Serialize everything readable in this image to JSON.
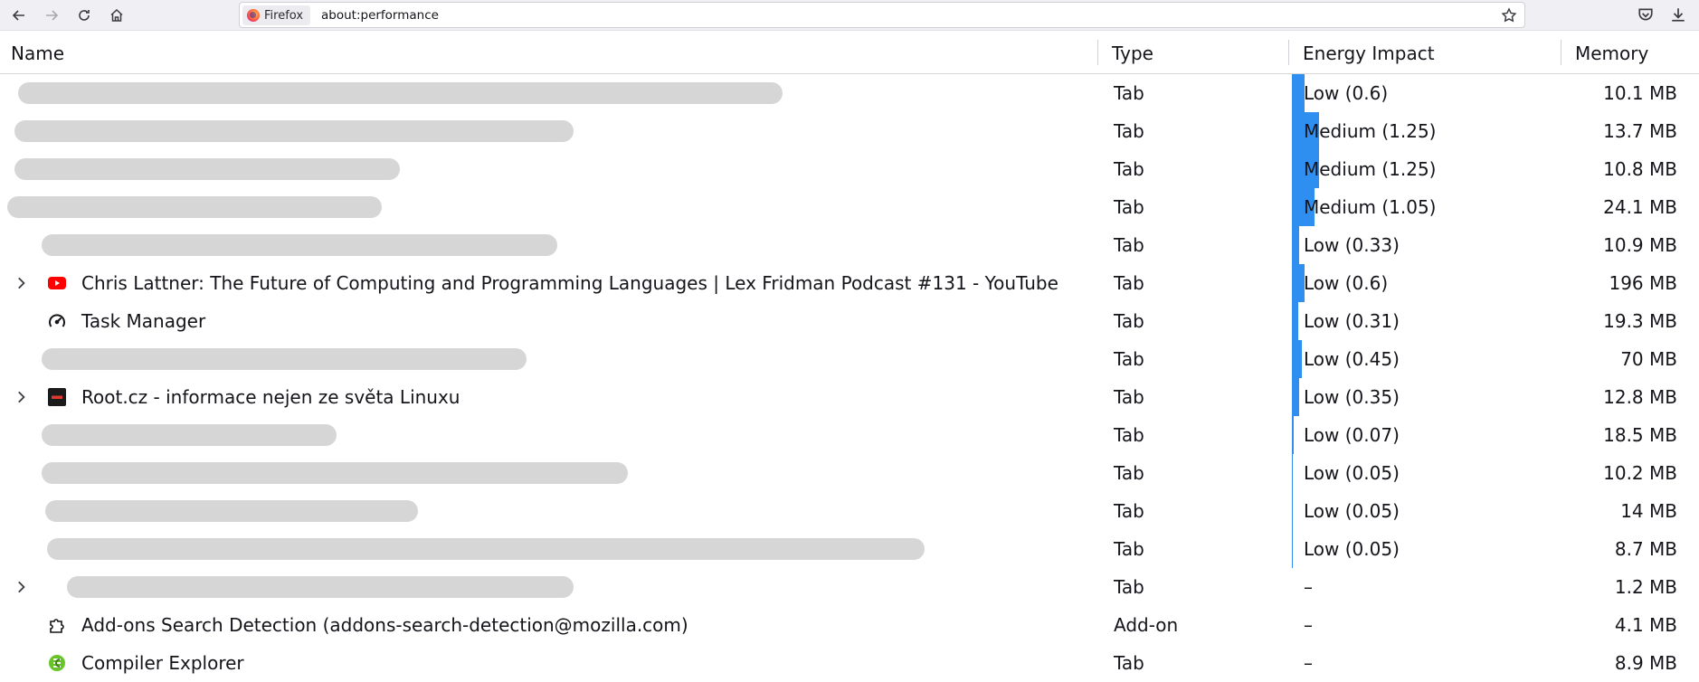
{
  "toolbar": {
    "identity_label": "Firefox",
    "url": "about:performance",
    "icons": [
      "back-arrow-icon",
      "forward-arrow-icon",
      "reload-icon",
      "home-icon",
      "bookmark-star-icon",
      "pocket-icon",
      "downloads-icon"
    ]
  },
  "columns": {
    "name": "Name",
    "type": "Type",
    "energy": "Energy Impact",
    "memory": "Memory"
  },
  "rows": [
    {
      "name": "",
      "type": "Tab",
      "energy": "Low (0.6)",
      "energy_value": 0.6,
      "memory": "10.1 MB"
    },
    {
      "name": "",
      "type": "Tab",
      "energy": "Medium (1.25)",
      "energy_value": 1.25,
      "memory": "13.7 MB"
    },
    {
      "name": "",
      "type": "Tab",
      "energy": "Medium (1.25)",
      "energy_value": 1.25,
      "memory": "10.8 MB"
    },
    {
      "name": "",
      "type": "Tab",
      "energy": "Medium (1.05)",
      "energy_value": 1.05,
      "memory": "24.1 MB"
    },
    {
      "name": "",
      "type": "Tab",
      "energy": "Low (0.33)",
      "energy_value": 0.33,
      "memory": "10.9 MB"
    },
    {
      "name": "Chris Lattner: The Future of Computing and Programming Languages | Lex Fridman Podcast #131 - YouTube",
      "type": "Tab",
      "energy": "Low (0.6)",
      "energy_value": 0.6,
      "memory": "196 MB"
    },
    {
      "name": "Task Manager",
      "type": "Tab",
      "energy": "Low (0.31)",
      "energy_value": 0.31,
      "memory": "19.3 MB"
    },
    {
      "name": "",
      "type": "Tab",
      "energy": "Low (0.45)",
      "energy_value": 0.45,
      "memory": "70 MB"
    },
    {
      "name": "Root.cz - informace nejen ze světa Linuxu",
      "type": "Tab",
      "energy": "Low (0.35)",
      "energy_value": 0.35,
      "memory": "12.8 MB"
    },
    {
      "name": "",
      "type": "Tab",
      "energy": "Low (0.07)",
      "energy_value": 0.07,
      "memory": "18.5 MB"
    },
    {
      "name": "",
      "type": "Tab",
      "energy": "Low (0.05)",
      "energy_value": 0.05,
      "memory": "10.2 MB"
    },
    {
      "name": "",
      "type": "Tab",
      "energy": "Low (0.05)",
      "energy_value": 0.05,
      "memory": "14 MB"
    },
    {
      "name": "",
      "type": "Tab",
      "energy": "Low (0.05)",
      "energy_value": 0.05,
      "memory": "8.7 MB"
    },
    {
      "name": "",
      "type": "Tab",
      "energy": "–",
      "energy_value": 0,
      "memory": "1.2 MB"
    },
    {
      "name": "Add-ons Search Detection (addons-search-detection@mozilla.com)",
      "type": "Add-on",
      "energy": "–",
      "energy_value": 0,
      "memory": "4.1 MB"
    },
    {
      "name": "Compiler Explorer",
      "type": "Tab",
      "energy": "–",
      "energy_value": 0,
      "memory": "8.9 MB"
    }
  ]
}
